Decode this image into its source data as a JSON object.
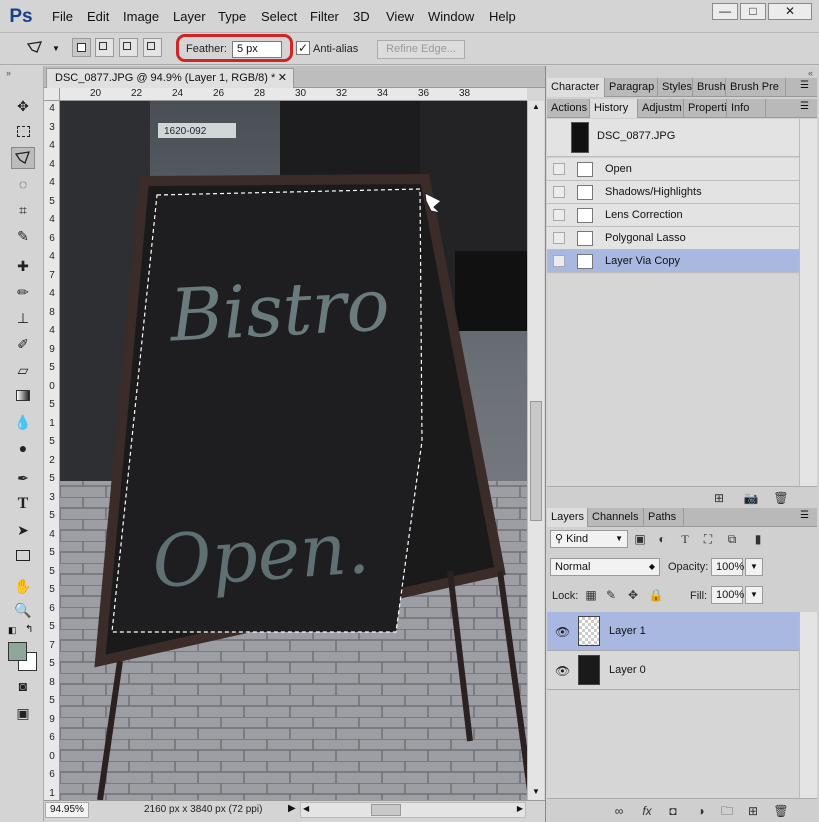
{
  "app": {
    "logo": "Ps"
  },
  "menu": [
    "File",
    "Edit",
    "Image",
    "Layer",
    "Type",
    "Select",
    "Filter",
    "3D",
    "View",
    "Window",
    "Help"
  ],
  "window_controls": {
    "minimize": "—",
    "maximize": "□",
    "close": "✕"
  },
  "options": {
    "feather_label": "Feather:",
    "feather_value": "5 px",
    "antialias_label": "Anti-alias",
    "antialias_checked": "✓",
    "refine_edge_label": "Refine Edge..."
  },
  "document": {
    "tab_title": "DSC_0877.JPG @ 94.9% (Layer 1, RGB/8) *",
    "close_glyph": "✕",
    "zoom": "94.95%",
    "size_info": "2160 px x 3840 px (72 ppi)"
  },
  "ruler": {
    "horizontal": [
      "20",
      "22",
      "24",
      "26",
      "28",
      "30",
      "32",
      "34",
      "36",
      "38"
    ],
    "vertical": [
      "4",
      "3",
      "4",
      "4",
      "4",
      "5",
      "4",
      "6",
      "4",
      "7",
      "4",
      "8",
      "4",
      "9",
      "5",
      "0",
      "5",
      "1",
      "5",
      "2",
      "5",
      "3",
      "5",
      "4",
      "5",
      "5",
      "5",
      "6",
      "5",
      "7",
      "5",
      "8",
      "5",
      "9",
      "6",
      "0",
      "6",
      "1"
    ]
  },
  "canvas": {
    "sign_line1": "Bistro",
    "sign_line2": "Open.",
    "plate": "1620-092"
  },
  "panels": {
    "top_tabs": [
      "Character",
      "Paragrap",
      "Styles",
      "Brush",
      "Brush Pre"
    ],
    "mid_tabs": [
      "Actions",
      "History",
      "Adjustm",
      "Properti",
      "Info"
    ],
    "history_snapshot": "DSC_0877.JPG",
    "history": [
      {
        "label": "Open"
      },
      {
        "label": "Shadows/Highlights"
      },
      {
        "label": "Lens Correction"
      },
      {
        "label": "Polygonal Lasso"
      },
      {
        "label": "Layer Via Copy"
      }
    ],
    "layer_tabs": [
      "Layers",
      "Channels",
      "Paths"
    ],
    "filter_kind": "Kind",
    "blend_mode": "Normal",
    "opacity_label": "Opacity:",
    "opacity_value": "100%",
    "lock_label": "Lock:",
    "fill_label": "Fill:",
    "fill_value": "100%",
    "layers": [
      {
        "name": "Layer 1"
      },
      {
        "name": "Layer 0"
      }
    ]
  },
  "colors": {
    "accent_selection": "#a9b8e0",
    "highlight_ring": "#d22424",
    "logo": "#1a3f8a"
  }
}
